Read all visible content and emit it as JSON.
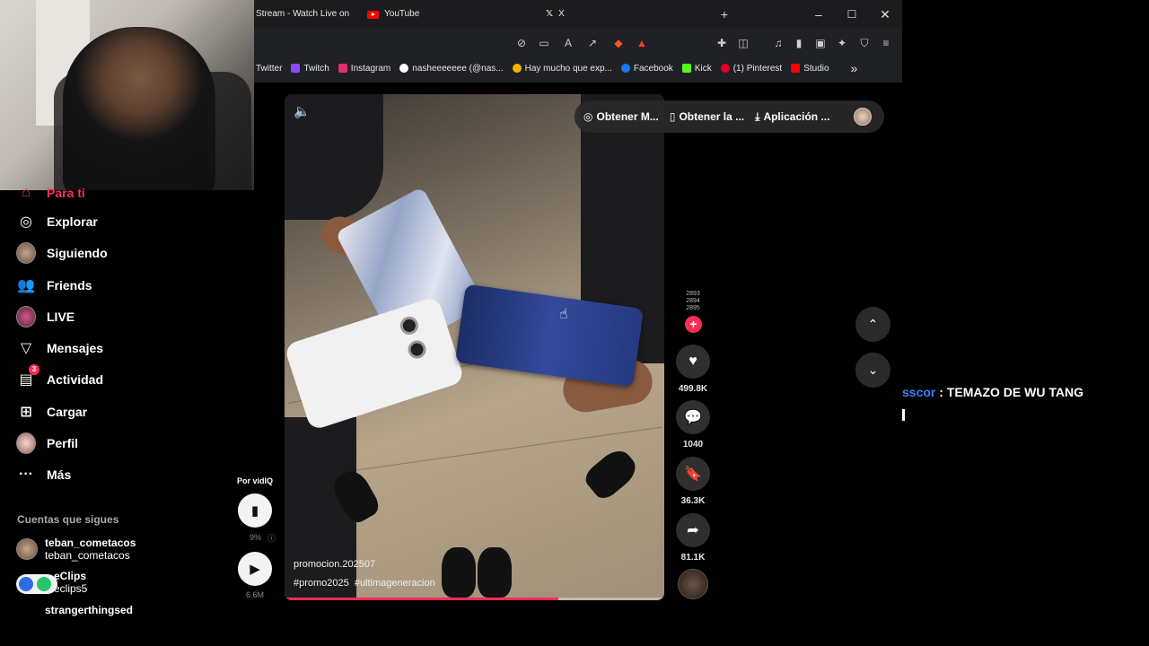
{
  "browser": {
    "tabs": [
      {
        "label": "Stream - Watch Live on"
      },
      {
        "label": "YouTube"
      },
      {
        "label": "X"
      }
    ],
    "new_tab_symbol": "+",
    "window_controls": {
      "minimize": "–",
      "maximize": "☐",
      "close": "✕"
    },
    "bookmarks": [
      {
        "label": "Twitter",
        "color": "#1d9bf0"
      },
      {
        "label": "Twitch",
        "color": "#9146ff"
      },
      {
        "label": "Instagram",
        "color": "#e1306c"
      },
      {
        "label": "nasheeeeeee (@nas...",
        "color": "#ffffff"
      },
      {
        "label": "Hay mucho que exp...",
        "color": "#f4b400"
      },
      {
        "label": "Facebook",
        "color": "#1877f2"
      },
      {
        "label": "Kick",
        "color": "#53fc18"
      },
      {
        "label": "(1) Pinterest",
        "color": "#e60023"
      },
      {
        "label": "Studio",
        "color": "#ff0000"
      }
    ],
    "more_bookmarks": "»"
  },
  "sidebar": {
    "partial_top": "Para ti",
    "items": [
      {
        "label": "Explorar",
        "icon": "compass-icon"
      },
      {
        "label": "Siguiendo",
        "icon": "avatar"
      },
      {
        "label": "Friends",
        "icon": "friends-icon"
      },
      {
        "label": "LIVE",
        "icon": "live-avatar"
      },
      {
        "label": "Mensajes",
        "icon": "send-icon"
      },
      {
        "label": "Actividad",
        "icon": "inbox-icon",
        "badge": "3"
      },
      {
        "label": "Cargar",
        "icon": "upload-icon"
      },
      {
        "label": "Perfil",
        "icon": "profile-avatar"
      },
      {
        "label": "Más",
        "icon": "more-icon"
      }
    ],
    "following_title": "Cuentas que sigues",
    "following": [
      {
        "name": "teban_cometacos",
        "handle": "teban_cometacos"
      },
      {
        "name": "eClips",
        "handle": "eclips5"
      },
      {
        "name": "strangerthingsed",
        "handle": ""
      }
    ]
  },
  "video": {
    "username": "promocion.202507",
    "tags": "#promo2025  #ultimageneracion",
    "progress": 0.72
  },
  "overlay_pills": [
    {
      "label": "Obtener M..."
    },
    {
      "label": "Obtener la ..."
    },
    {
      "label": "Aplicación ..."
    }
  ],
  "actions": {
    "likes": "499.8K",
    "comments": "1040",
    "saves": "36.3K",
    "shares": "81.1K",
    "stacked_numbers": [
      "2893",
      "2894",
      "2895"
    ]
  },
  "vidiq": {
    "label": "Por vidIQ",
    "percent": "9%",
    "views": "6.6M"
  },
  "chat": {
    "user": "sscor",
    "message": " : TEMAZO DE WU TANG"
  },
  "colors": {
    "accent": "#fe2c55",
    "chat_user": "#3d7fff"
  }
}
